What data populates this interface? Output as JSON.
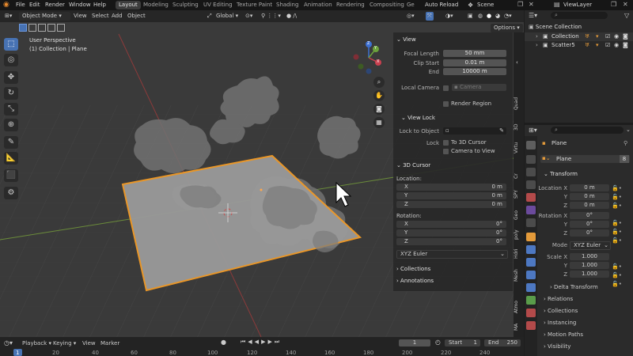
{
  "menubar": {
    "items": [
      "File",
      "Edit",
      "Render",
      "Window",
      "Help"
    ],
    "workspaces": [
      "Layout",
      "Modeling",
      "Sculpting",
      "UV Editing",
      "Texture Paint",
      "Shading",
      "Animation",
      "Rendering",
      "Compositing",
      "Ge"
    ],
    "auto_reload": "Auto Reload",
    "scene": "Scene",
    "view_layer": "ViewLayer"
  },
  "viewport_header": {
    "mode": "Object Mode",
    "menus": [
      "View",
      "Select",
      "Add",
      "Object"
    ],
    "orientation": "Global",
    "options": "Options"
  },
  "viewport": {
    "perspective": "User Perspective",
    "collection_info": "(1) Collection | Plane",
    "gizmo": {
      "x": "X",
      "y": "Y",
      "z": "Z"
    }
  },
  "npanel": {
    "view_title": "View",
    "focal_length_label": "Focal Length",
    "focal_length": "50 mm",
    "clip_start_label": "Clip Start",
    "clip_start": "0.01 m",
    "clip_end_label": "End",
    "clip_end": "10000 m",
    "local_camera_label": "Local Camera",
    "camera_placeholder": "Camera",
    "render_region": "Render Region",
    "view_lock_title": "View Lock",
    "lock_to_object": "Lock to Object",
    "lock_label": "Lock",
    "to_3d_cursor": "To 3D Cursor",
    "camera_to_view": "Camera to View",
    "cursor_title": "3D Cursor",
    "location_label": "Location:",
    "loc": [
      {
        "axis": "X",
        "value": "0 m"
      },
      {
        "axis": "Y",
        "value": "0 m"
      },
      {
        "axis": "Z",
        "value": "0 m"
      }
    ],
    "rotation_label": "Rotation:",
    "rot": [
      {
        "axis": "X",
        "value": "0°"
      },
      {
        "axis": "Y",
        "value": "0°"
      },
      {
        "axis": "Z",
        "value": "0°"
      }
    ],
    "rot_mode": "XYZ Euler",
    "collections": "Collections",
    "annotations": "Annotations",
    "tabs": [
      "Quad",
      "3D",
      "Virtu",
      "Cr",
      "SPY",
      "Geo",
      "poly",
      "Hdri",
      "Mesh",
      "Atmo",
      "MA"
    ]
  },
  "outliner": {
    "root": "Scene Collection",
    "items": [
      {
        "name": "Collection"
      },
      {
        "name": "Scatter5"
      }
    ]
  },
  "properties": {
    "object_name": "Plane",
    "data_name": "Plane",
    "users": "8",
    "transform_title": "Transform",
    "location_label": "Location X",
    "loc": [
      "0 m",
      "0 m",
      "0 m"
    ],
    "rotation_label": "Rotation X",
    "rot": [
      "0°",
      "0°",
      "0°"
    ],
    "axis_y": "Y",
    "axis_z": "Z",
    "mode_label": "Mode",
    "mode": "XYZ Euler",
    "scale_label": "Scale X",
    "scale": [
      "1.000",
      "1.000",
      "1.000"
    ],
    "delta": "Delta Transform",
    "sections": [
      "Relations",
      "Collections",
      "Instancing",
      "Motion Paths",
      "Visibility"
    ]
  },
  "timeline": {
    "menus": [
      "Playback",
      "Keying",
      "View",
      "Marker"
    ],
    "current_frame": "1",
    "start_label": "Start",
    "start": "1",
    "end_label": "End",
    "end": "250",
    "ruler": [
      "1",
      "20",
      "40",
      "60",
      "80",
      "100",
      "120",
      "140",
      "160",
      "180",
      "200",
      "220",
      "240"
    ]
  }
}
